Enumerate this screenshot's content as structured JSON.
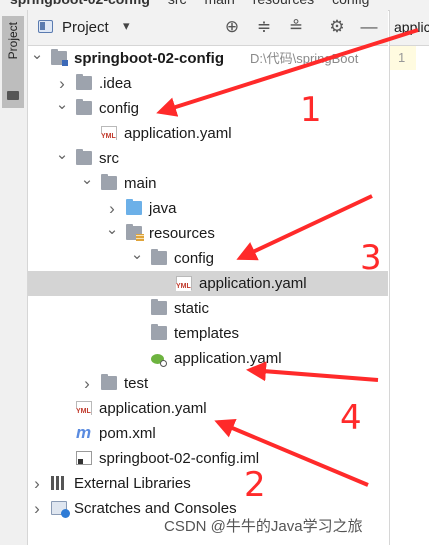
{
  "breadcrumbs": [
    "springboot-02-config",
    "src",
    "main",
    "resources",
    "config"
  ],
  "side_tab": "Project",
  "panel": {
    "title": "Project",
    "caret": "▾",
    "buttons": [
      "⊕",
      "≑",
      "≗",
      "⚙",
      "—"
    ]
  },
  "editor": {
    "tab_label": "applic",
    "line_number": "1"
  },
  "tree": [
    {
      "depth": 0,
      "arrow": "down",
      "icon": "folder-project-icon",
      "label": "springboot-02-config",
      "bold": true,
      "path": "D:\\代码\\springBoot"
    },
    {
      "depth": 1,
      "arrow": "right",
      "icon": "folder-icon",
      "label": ".idea"
    },
    {
      "depth": 1,
      "arrow": "down",
      "icon": "folder-icon",
      "label": "config"
    },
    {
      "depth": 2,
      "arrow": "",
      "icon": "yaml-file-icon",
      "label": "application.yaml"
    },
    {
      "depth": 1,
      "arrow": "down",
      "icon": "folder-icon",
      "label": "src"
    },
    {
      "depth": 2,
      "arrow": "down",
      "icon": "folder-icon",
      "label": "main"
    },
    {
      "depth": 3,
      "arrow": "right",
      "icon": "folder-source-icon",
      "label": "java"
    },
    {
      "depth": 3,
      "arrow": "down",
      "icon": "folder-resources-icon",
      "label": "resources"
    },
    {
      "depth": 4,
      "arrow": "down",
      "icon": "folder-icon",
      "label": "config"
    },
    {
      "depth": 5,
      "arrow": "",
      "icon": "yaml-file-icon",
      "label": "application.yaml",
      "selected": true
    },
    {
      "depth": 4,
      "arrow": "",
      "icon": "folder-icon",
      "label": "static"
    },
    {
      "depth": 4,
      "arrow": "",
      "icon": "folder-icon",
      "label": "templates"
    },
    {
      "depth": 4,
      "arrow": "",
      "icon": "spring-config-icon",
      "label": "application.yaml"
    },
    {
      "depth": 2,
      "arrow": "right",
      "icon": "folder-icon",
      "label": "test"
    },
    {
      "depth": 1,
      "arrow": "",
      "icon": "yaml-file-icon",
      "label": "application.yaml"
    },
    {
      "depth": 1,
      "arrow": "",
      "icon": "maven-pom-icon",
      "label": "pom.xml"
    },
    {
      "depth": 1,
      "arrow": "",
      "icon": "iml-file-icon",
      "label": "springboot-02-config.iml"
    },
    {
      "depth": 0,
      "arrow": "right",
      "icon": "external-libraries-icon",
      "label": "External Libraries"
    },
    {
      "depth": 0,
      "arrow": "right",
      "icon": "scratches-icon",
      "label": "Scratches and Consoles"
    }
  ],
  "annotations": {
    "color": "#ff2a2a",
    "numbers": [
      "1",
      "2",
      "3",
      "4"
    ]
  },
  "watermark": "CSDN @牛牛的Java学习之旅"
}
